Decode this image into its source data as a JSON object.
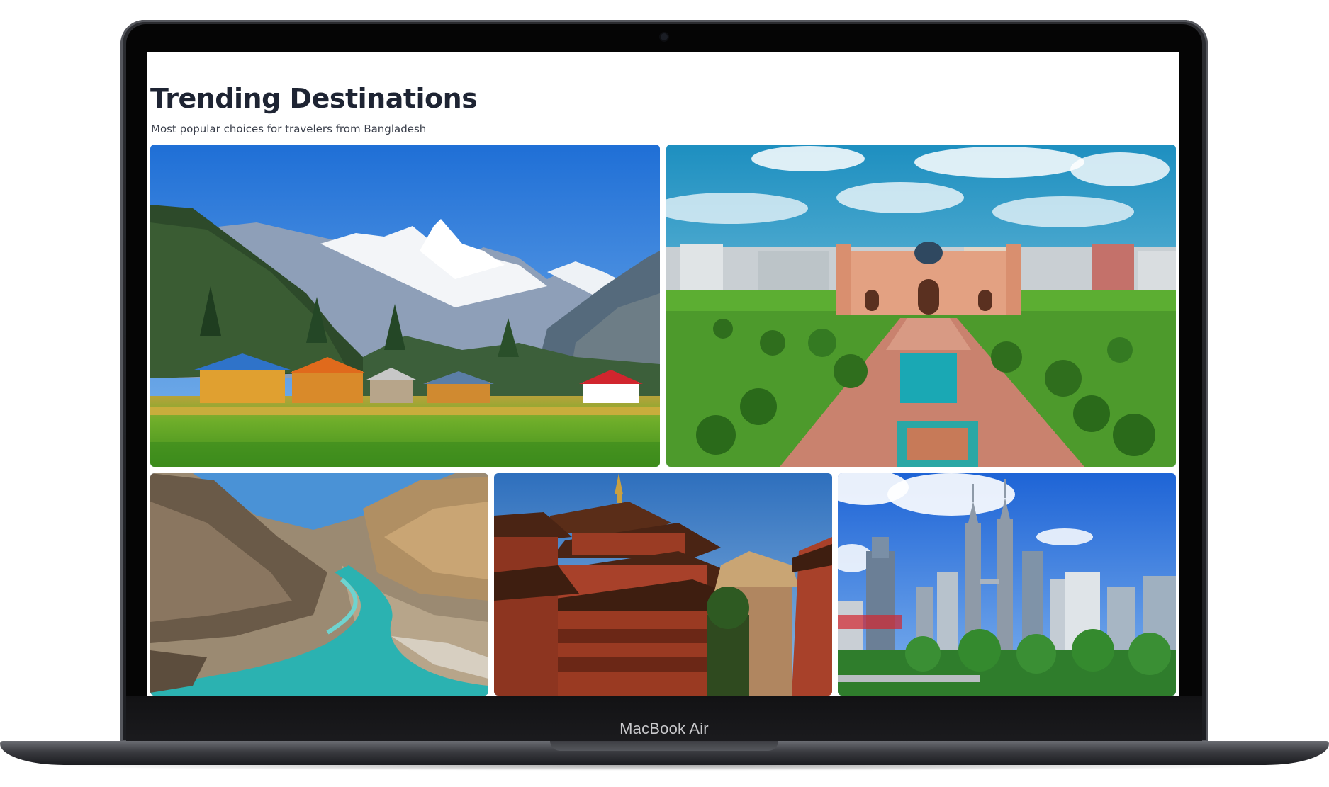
{
  "page": {
    "title": "Trending Destinations",
    "subtitle": "Most popular choices for travelers from Bangladesh"
  },
  "device": {
    "label": "MacBook Air"
  },
  "destinations": [
    {
      "image": "mountain-valley-village",
      "accent": "#1e6fd9"
    },
    {
      "image": "mughal-fort-garden",
      "accent": "#c9774f"
    },
    {
      "image": "river-confluence-mountains",
      "accent": "#1fb7b0"
    },
    {
      "image": "pagoda-temple",
      "accent": "#9a3a22"
    },
    {
      "image": "city-skyline-twin-towers",
      "accent": "#2b6fe0"
    }
  ],
  "colors": {
    "title": "#1e2433",
    "subtitle": "#3a3f4b",
    "screen_bg": "#ffffff"
  }
}
